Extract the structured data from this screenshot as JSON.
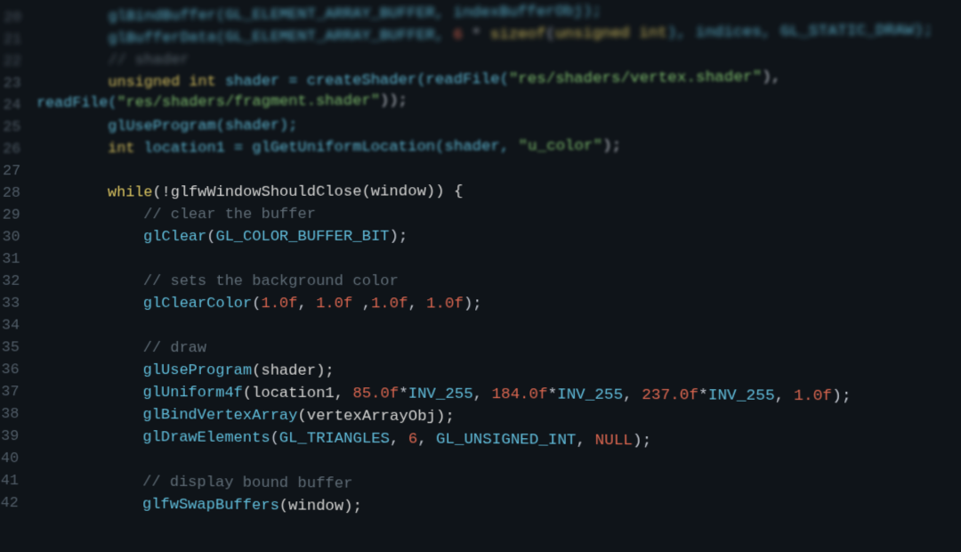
{
  "gutter": [
    "20",
    "21",
    "22",
    "23",
    "24",
    "25",
    "26",
    "27",
    "28",
    "29",
    "30",
    "31",
    "32",
    "33",
    "34",
    "35",
    "36",
    "37",
    "38",
    "39",
    "40",
    "41",
    "42"
  ],
  "code": {
    "l20_a": "        glBindBuffer(GL_ELEMENT_ARRAY_BUFFER, indexBufferObj);",
    "l21_a": "        glBufferData(GL_ELEMENT_ARRAY_BUFFER, ",
    "l21_num": "6",
    "l21_b": " * ",
    "l21_kw": "sizeof",
    "l21_c": "(",
    "l21_kw2": "unsigned int",
    "l21_d": "), indices, GL_STATIC_DRAW);",
    "l22_cmt": "        // shader",
    "l23_kw": "        unsigned int",
    "l23_a": " shader = createShader(readFile(",
    "l23_s1": "\"res/shaders/vertex.shader\"",
    "l23_b": "),",
    "l23w_a": "readFile(",
    "l23w_s": "\"res/shaders/fragment.shader\"",
    "l23w_b": "));",
    "l24_a": "        glUseProgram(shader);",
    "l25_kw": "        int",
    "l25_a": " location1 = glGetUniformLocation(shader, ",
    "l25_s": "\"u_color\"",
    "l25_b": ");",
    "l27_kw": "        while",
    "l27_a": "(!glfwWindowShouldClose(window)) {",
    "l28_cmt": "            // clear the buffer",
    "l29_fn": "            glClear",
    "l29_a": "(",
    "l29_c": "GL_COLOR_BUFFER_BIT",
    "l29_b": ");",
    "l31_cmt": "            // sets the background color",
    "l32_fn": "            glClearColor",
    "l32_a": "(",
    "l32_n1": "1.0f",
    "l32_b": ", ",
    "l32_n2": "1.0f",
    "l32_c": " ,",
    "l32_n3": "1.0f",
    "l32_d": ", ",
    "l32_n4": "1.0f",
    "l32_e": ");",
    "l34_cmt": "            // draw",
    "l35_fn": "            glUseProgram",
    "l35_a": "(shader);",
    "l36_fn": "            glUniform4f",
    "l36_a": "(location1, ",
    "l36_n1": "85.0f",
    "l36_b": "*",
    "l36_i1": "INV_255",
    "l36_c": ", ",
    "l36_n2": "184.0f",
    "l36_d": "*",
    "l36_i2": "INV_255",
    "l36_e": ", ",
    "l36_n3": "237.0f",
    "l36_f": "*",
    "l36_i3": "INV_255",
    "l36_g": ", ",
    "l36_n4": "1.0f",
    "l36_h": ");",
    "l37_fn": "            glBindVertexArray",
    "l37_a": "(vertexArrayObj);",
    "l38_fn": "            glDrawElements",
    "l38_a": "(",
    "l38_c1": "GL_TRIANGLES",
    "l38_b": ", ",
    "l38_n": "6",
    "l38_c": ", ",
    "l38_c2": "GL_UNSIGNED_INT",
    "l38_d": ", ",
    "l38_null": "NULL",
    "l38_e": ");",
    "l40_cmt": "            // display bound buffer",
    "l41_fn": "            glfwSwapBuffers",
    "l41_a": "(window);"
  }
}
